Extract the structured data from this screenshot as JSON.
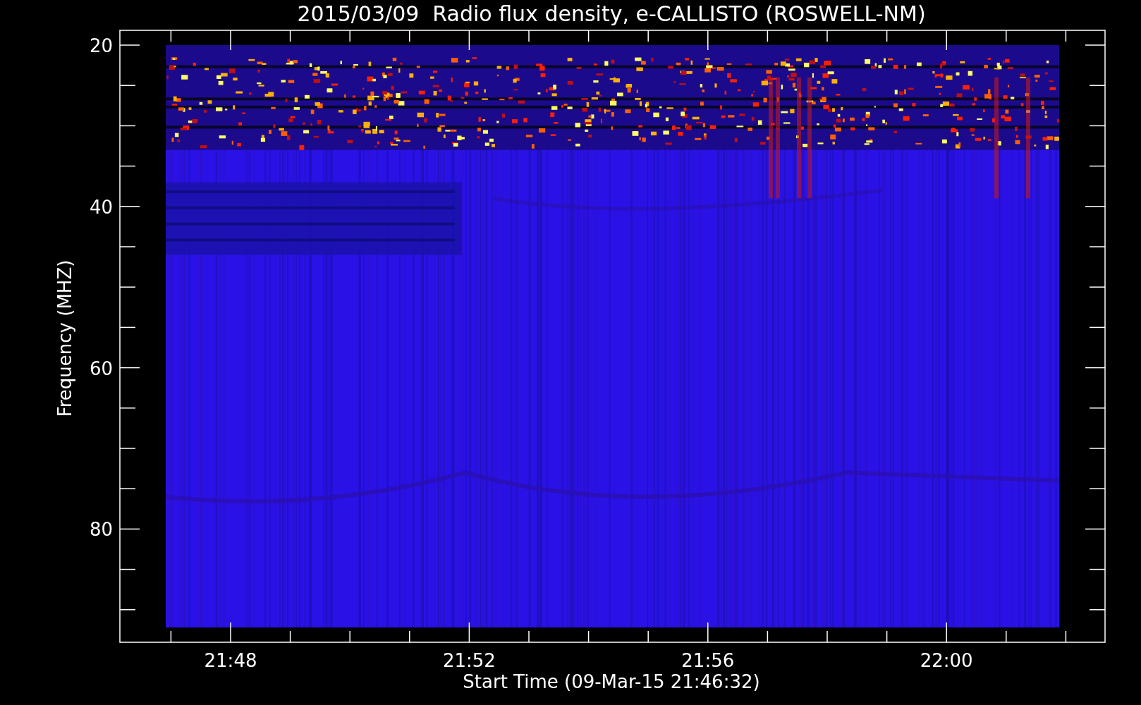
{
  "plot": {
    "title": "2015/03/09  Radio flux density, e-CALLISTO (ROSWELL-NM)",
    "ylabel": "Frequency (MHZ)",
    "xlabel": "Start Time (09-Mar-15 21:46:32)",
    "y_ticks": [
      "20",
      "40",
      "60",
      "80"
    ],
    "x_ticks": [
      "21:48",
      "21:52",
      "21:56",
      "22:00"
    ]
  }
}
